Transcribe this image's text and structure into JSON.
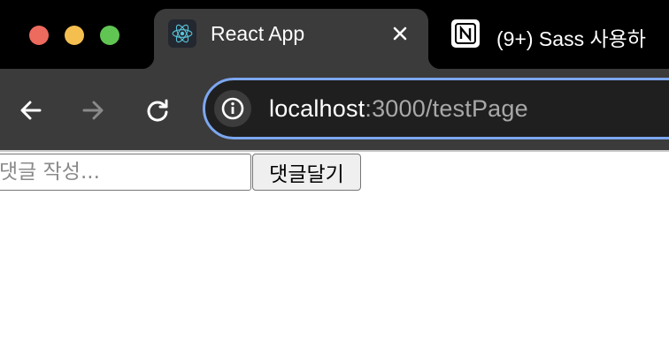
{
  "browser": {
    "tabs": [
      {
        "title": "React App",
        "favicon": "react-logo-icon",
        "active": true
      },
      {
        "title": "(9+) Sass 사용하",
        "favicon": "notion-logo-icon",
        "active": false
      }
    ],
    "address_bar": {
      "host": "localhost",
      "rest": ":3000/testPage"
    },
    "colors": {
      "accent": "#7ca7f0",
      "toolbar": "#3b3b3b",
      "tabstrip": "#000000"
    }
  },
  "page": {
    "comment_input": {
      "placeholder": "댓글 작성...",
      "value": ""
    },
    "submit_label": "댓글달기"
  }
}
